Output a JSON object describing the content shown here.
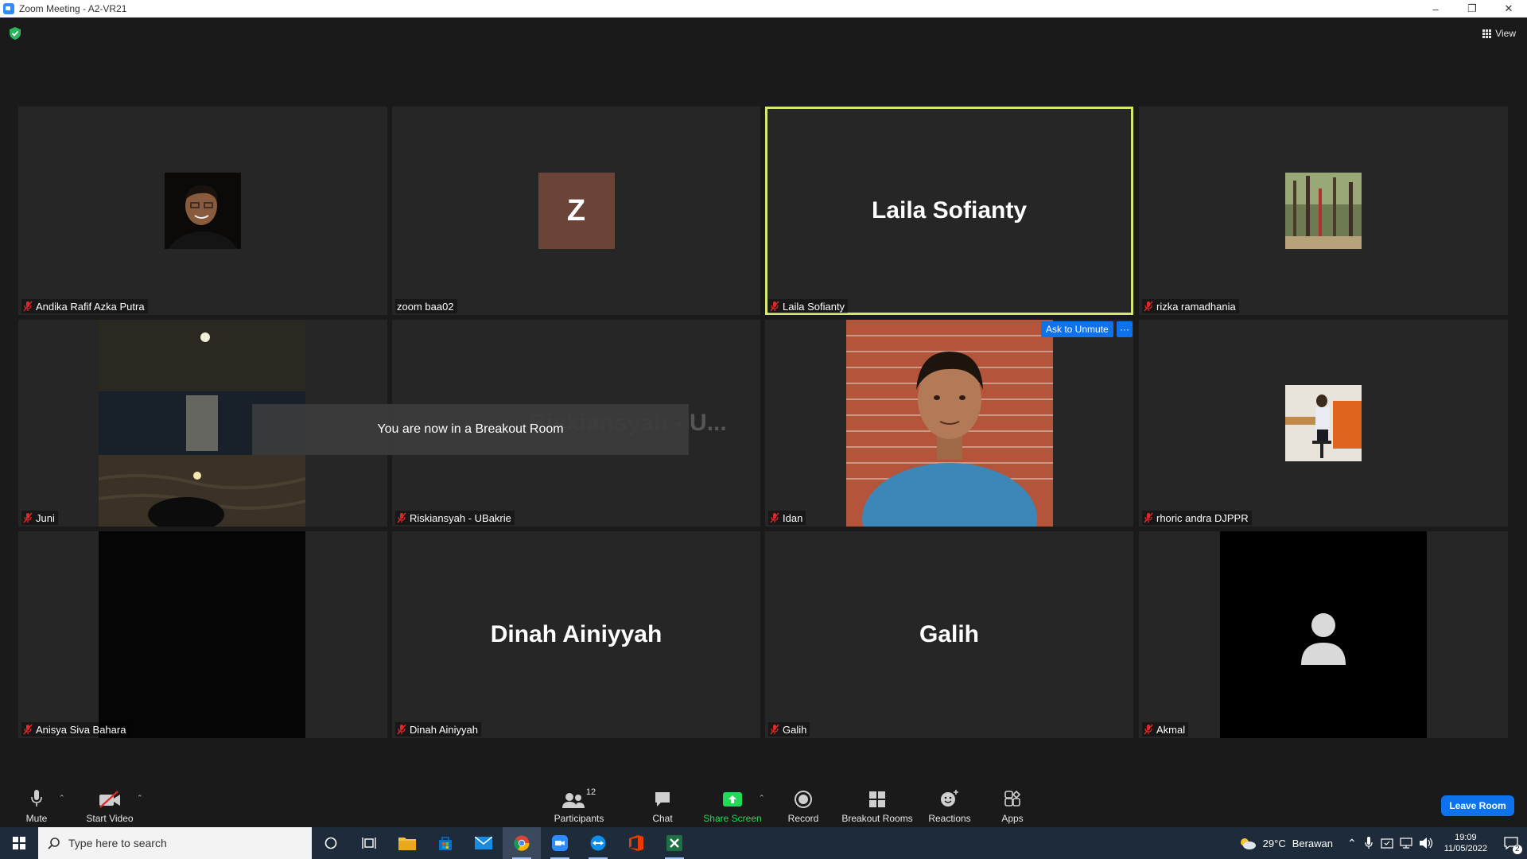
{
  "window": {
    "title": "Zoom Meeting - A2-VR21"
  },
  "top": {
    "view_label": "View"
  },
  "tiles": [
    {
      "name": "Andika Rafif Azka Putra",
      "big_name": "",
      "avatar_letter": ""
    },
    {
      "name": "zoom baa02",
      "big_name": "",
      "avatar_letter": "Z"
    },
    {
      "name": "Laila Sofianty",
      "big_name": "Laila Sofianty",
      "avatar_letter": ""
    },
    {
      "name": "rizka ramadhania",
      "big_name": "",
      "avatar_letter": ""
    },
    {
      "name": "Juni",
      "big_name": "",
      "avatar_letter": ""
    },
    {
      "name": "Riskiansyah - UBakrie",
      "big_name": "Riskiansyah - U...",
      "avatar_letter": ""
    },
    {
      "name": "Idan",
      "big_name": "",
      "avatar_letter": ""
    },
    {
      "name": "rhoric andra DJPPR",
      "big_name": "",
      "avatar_letter": ""
    },
    {
      "name": "Anisya Siva Bahara",
      "big_name": "",
      "avatar_letter": ""
    },
    {
      "name": "Dinah Ainiyyah",
      "big_name": "Dinah Ainiyyah",
      "avatar_letter": ""
    },
    {
      "name": "Galih",
      "big_name": "Galih",
      "avatar_letter": ""
    },
    {
      "name": "Akmal",
      "big_name": "",
      "avatar_letter": ""
    }
  ],
  "toasts": {
    "breakout": "You are now in a Breakout Room",
    "ask_unmute": "Ask to Unmute",
    "more": "···"
  },
  "toolbar": {
    "mute": "Mute",
    "start_video": "Start Video",
    "participants": "Participants",
    "participants_count": "12",
    "chat": "Chat",
    "share_screen": "Share Screen",
    "record": "Record",
    "breakout_rooms": "Breakout Rooms",
    "reactions": "Reactions",
    "apps": "Apps",
    "leave": "Leave Room"
  },
  "taskbar": {
    "search_placeholder": "Type here to search",
    "weather_temp": "29°C",
    "weather_desc": "Berawan",
    "time": "19:09",
    "date": "11/05/2022",
    "notification_count": "2"
  },
  "colors": {
    "accent": "#0e72ed",
    "active_speaker": "#d6e86d",
    "share_green": "#23d959",
    "muted_red": "#e02828",
    "avatar_z": "#6b4438"
  }
}
